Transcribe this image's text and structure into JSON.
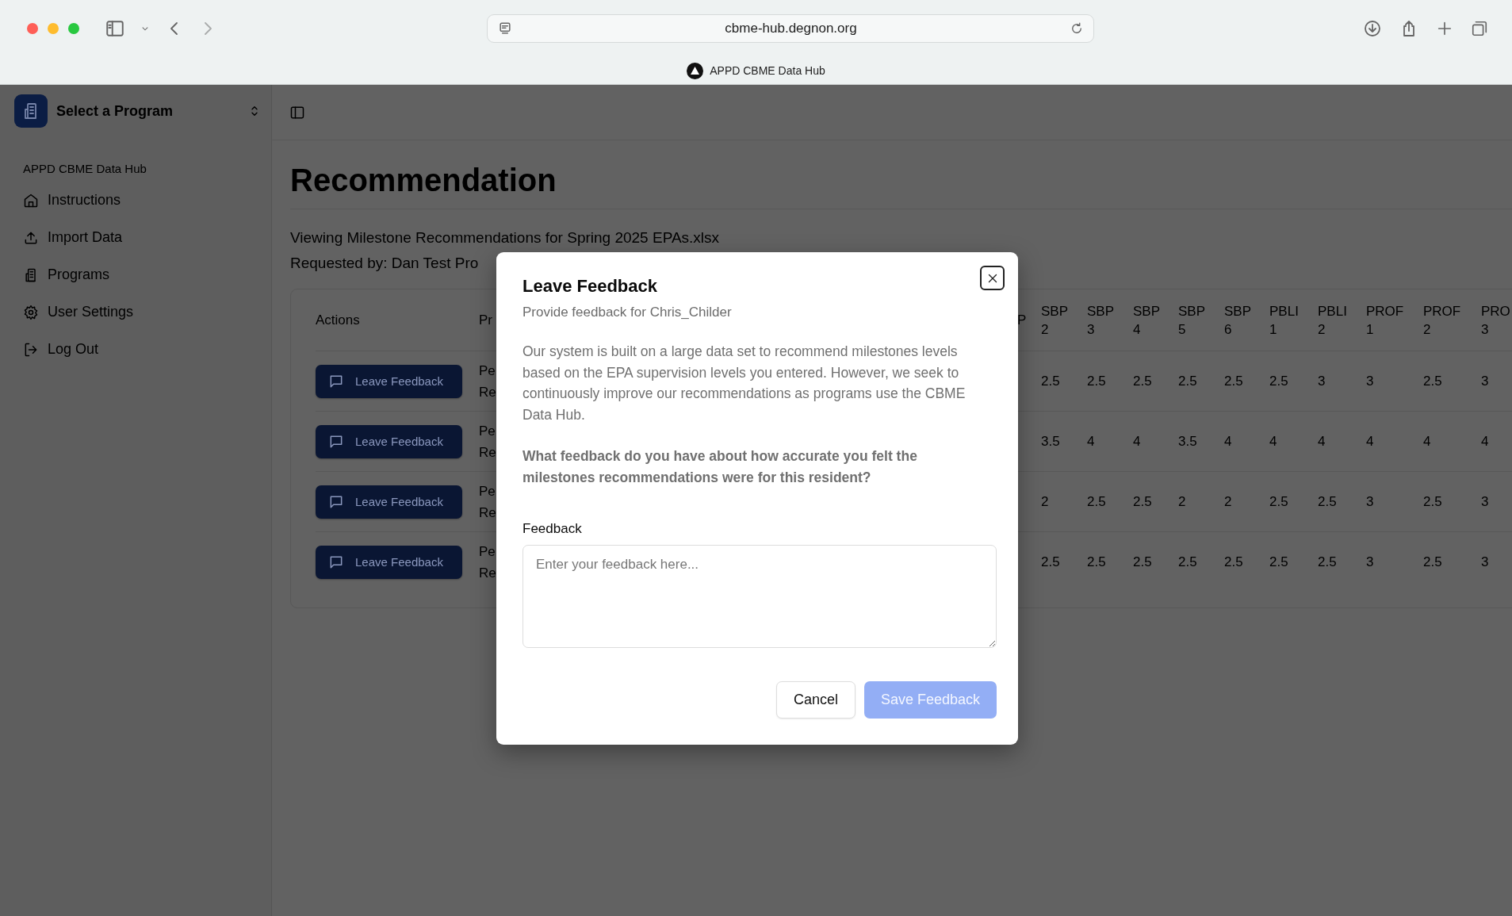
{
  "browser": {
    "url": "cbme-hub.degnon.org",
    "tab_title": "APPD CBME Data Hub"
  },
  "sidebar": {
    "program_selector": "Select a Program",
    "section_label": "APPD CBME Data Hub",
    "items": [
      {
        "label": "Instructions"
      },
      {
        "label": "Import Data"
      },
      {
        "label": "Programs"
      },
      {
        "label": "User Settings"
      },
      {
        "label": "Log Out"
      }
    ]
  },
  "page": {
    "title": "Recommendation",
    "lines": [
      "Viewing Milestone Recommendations for Spring 2025 EPAs.xlsx",
      "Requested by: Dan Test Pro"
    ],
    "table": {
      "columns": [
        {
          "label": "Actions",
          "kind": "action"
        },
        {
          "label": "Pr",
          "kind": "text"
        },
        {
          "label": "P",
          "kind": "score"
        },
        {
          "label": "SBP 2",
          "kind": "score"
        },
        {
          "label": "SBP 3",
          "kind": "score"
        },
        {
          "label": "SBP 4",
          "kind": "score"
        },
        {
          "label": "SBP 5",
          "kind": "score"
        },
        {
          "label": "SBP 6",
          "kind": "score"
        },
        {
          "label": "PBLI 1",
          "kind": "score"
        },
        {
          "label": "PBLI 2",
          "kind": "score"
        },
        {
          "label": "PROF 1",
          "kind": "score"
        },
        {
          "label": "PROF 2",
          "kind": "score"
        },
        {
          "label": "PRO 3",
          "kind": "score"
        }
      ],
      "rows": [
        {
          "action": "Leave Feedback",
          "column_2": [
            "Pe",
            "Re"
          ],
          "scores": [
            "2.5",
            "2.5",
            "2.5",
            "2.5",
            "2.5",
            "2.5",
            "3",
            "3",
            "2.5",
            "3"
          ]
        },
        {
          "action": "Leave Feedback",
          "column_2": [
            "Pe",
            "Re"
          ],
          "scores": [
            "3.5",
            "4",
            "4",
            "3.5",
            "4",
            "4",
            "4",
            "4",
            "4",
            "4"
          ]
        },
        {
          "action": "Leave Feedback",
          "column_2": [
            "Pe",
            "Re"
          ],
          "scores": [
            "2",
            "2.5",
            "2.5",
            "2",
            "2",
            "2.5",
            "2.5",
            "3",
            "2.5",
            "3"
          ]
        },
        {
          "action": "Leave Feedback",
          "column_2": [
            "Pe",
            "Re"
          ],
          "scores": [
            "2.5",
            "2.5",
            "2.5",
            "2.5",
            "2.5",
            "2.5",
            "2.5",
            "3",
            "2.5",
            "3"
          ]
        }
      ]
    }
  },
  "dialog": {
    "title": "Leave Feedback",
    "subtitle": "Provide feedback for Chris_Childer",
    "body": "Our system is built on a large data set to recommend milestones levels based on the EPA supervision levels you entered. However, we seek to continuously improve our recommendations as programs use the CBME Data Hub.",
    "question": "What feedback do you have about how accurate you felt the milestones recommendations were for this resident?",
    "field_label": "Feedback",
    "placeholder": "Enter your feedback here...",
    "buttons": [
      {
        "label": "Cancel",
        "kind": "secondary",
        "disabled": false
      },
      {
        "label": "Save Feedback",
        "kind": "primary",
        "disabled": true
      }
    ]
  }
}
